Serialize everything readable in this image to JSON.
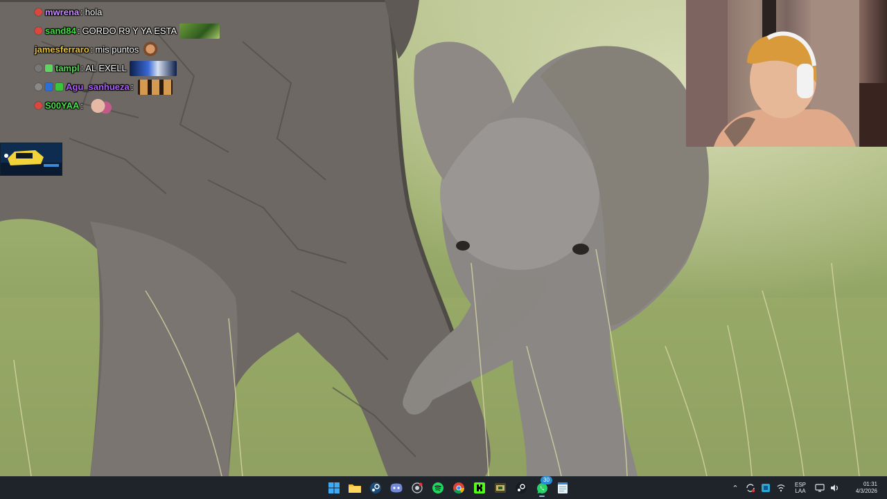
{
  "chat": [
    {
      "author": "mwrena",
      "author_color": "#c88cff",
      "message": "hola",
      "badge_color": "#d9473f",
      "emote": null
    },
    {
      "author": "sand84",
      "author_color": "#3de33d",
      "message": "GORDO R9 Y YA ESTA",
      "badge_color": "#d9473f",
      "emote": "grass-emote"
    },
    {
      "author": "jamesferraro",
      "author_color": "#e6c23a",
      "message": "mis puntos",
      "badge_color": null,
      "emote": "face-emote"
    },
    {
      "author": "tampl",
      "author_color": "#5cd65c",
      "message": "AL EXELL",
      "badge_color": "#888888",
      "emote": "car-emote"
    },
    {
      "author": "Agu_sanhueza",
      "author_color": "#b05cff",
      "message": "",
      "badge_color": "#2b6fd6",
      "emote": "triple-face-emote"
    },
    {
      "author": "S00YAA",
      "author_color": "#4be04b",
      "message": "",
      "badge_color": "#d9473f",
      "emote": "hand-emote"
    }
  ],
  "taskbar": {
    "apps": [
      {
        "name": "start-button",
        "icon": "windows-icon"
      },
      {
        "name": "file-explorer",
        "icon": "folder-icon"
      },
      {
        "name": "steam-app",
        "icon": "steam-icon"
      },
      {
        "name": "discord-app",
        "icon": "discord-icon"
      },
      {
        "name": "obs-app",
        "icon": "record-icon"
      },
      {
        "name": "spotify-app",
        "icon": "spotify-icon"
      },
      {
        "name": "chrome-app",
        "icon": "chrome-icon"
      },
      {
        "name": "kick-app",
        "icon": "kick-icon"
      },
      {
        "name": "game-app",
        "icon": "game-icon"
      },
      {
        "name": "steam-app-2",
        "icon": "steam-icon"
      },
      {
        "name": "whatsapp-app",
        "icon": "whatsapp-icon",
        "badge": "30"
      },
      {
        "name": "notepad-app",
        "icon": "notepad-icon"
      }
    ],
    "tray": {
      "language_top": "ESP",
      "language_bottom": "LAA",
      "time": "01:31",
      "date": "4/3/2026"
    }
  },
  "colors": {
    "taskbar_bg": "#1e242a",
    "accent": "#2a8bd6"
  }
}
